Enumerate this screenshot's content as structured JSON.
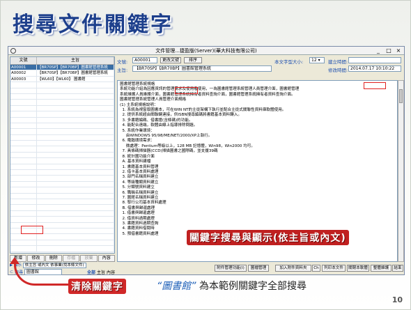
{
  "slide": {
    "title": "搜尋文件關鍵字",
    "page_number": "10",
    "callout_main": "關鍵字搜尋與顯示(依主旨或內文)",
    "callout_clear": "清除關鍵字",
    "caption_keyword": "“圖書館”",
    "caption_text": "為本範例關鍵字全部搜尋"
  },
  "window": {
    "title": "文件管理...捷盈版(Server)(華大科技有限公司)",
    "minimize": "_",
    "maximize": "□",
    "close": "×"
  },
  "grid": {
    "col_doc": "文號",
    "col_subject": "主旨",
    "rows": [
      {
        "doc": "A00001",
        "subject": "【BR70SP】【BR70BP】圖書館管理系統",
        "selected": true
      },
      {
        "doc": "A00002",
        "subject": "【BR70SP】【BR70BP】圖書館管理系統",
        "selected": false
      },
      {
        "doc": "A00003",
        "subject": "【WL60】【WL60】 圖書館",
        "selected": false
      }
    ],
    "empty_rows": 29
  },
  "left_buttons": [
    "新增",
    "修改",
    "刪除",
    "存檔",
    "放棄",
    "內容"
  ],
  "show_label": "顯示",
  "show_text": "依主旨 或內文 依事業(找本條文件)",
  "search": {
    "label": "搜尋",
    "value": "圖書館",
    "btn_all": "全部",
    "opt_subject": "主旨",
    "opt_content": "內容"
  },
  "form": {
    "doc_label": "文號:",
    "doc_value": "A00001",
    "change_btn": "更改文號",
    "sort_btn": "排序",
    "font_label": "本文字型大小:",
    "font_value": "12",
    "created_label": "建立時間:",
    "created_value": "",
    "subject_label": "主旨:",
    "subject_value": "【BR70SP】【BR70BP】圖書館管理系統",
    "modified_label": "修改時間:",
    "modified_value": "2014.07.17 10:10:22"
  },
  "content_lines": [
    "圖書館管理系統規格",
    "系統功能介紹為因應資訊的管理需求及使用者使用，一為圖書館管理系統管理人員管理介面，圖書館管理",
    "系統維護人員維護介面，圖書館管理系統擁有者資料查詢介面，圖書館管理系統擁有者資料查詢介面。",
    "",
    "圖書館管理系統管理人員管理介面規格",
    "(1) 主系統規格說明：",
    "  1. 系統為視窗版圖書本，可在WIN NT的主從架構下執行並配合主從式關聯性資料庫軟體使用。",
    "  2. 提供系統超由關聯鍵連接，供ISBN搜尋編碼將書籍基本資料轉入。",
    "  3. 多書籍編碼、借書證(含條碼)的功能。",
    "  4. 能配合遠端，軟體由線上指導排除問題。",
    "  5. 系統作業環境：",
    "     由WINDOWS 95/98/ME/NET/2000/XP上執行。",
    "  6. 電腦環境需求：",
    "     微處理：Pentium等級以上，128 MB 記憶體，Win98，Win2000 均可。",
    "  7. 具條碼掃描器(CCD)掃描圖書之國際碼，並支援39碼",
    "  8. 統計圖功能介面",
    "  A. 基本資料建檔",
    "  1. 書籍基本資料管理",
    "  2. 借卡基本資料處理",
    "  3. 部門名稱資料建立",
    "  4. 等級種類資料建立",
    "  5. 分類號資料建立",
    "  6. 職稱名稱資料建立",
    "  7. 圖館名稱資料建立",
    "  8. 發行公司基本資料處理",
    "  B. 借書與歸還處理",
    "  1. 借書與歸還處理",
    "  2. 借資料過期處理",
    "  3. 書籍資料過期查詢",
    "  4. 書籍資料借閱時",
    "  5. 預借書籍資料處理"
  ],
  "bottom_buttons": [
    "附件管理功能(I)",
    "圖檔管理",
    "加入附件資料夾",
    "Ch",
    "列印本文件",
    "關閉本軟體",
    "整體維護",
    "結束"
  ]
}
